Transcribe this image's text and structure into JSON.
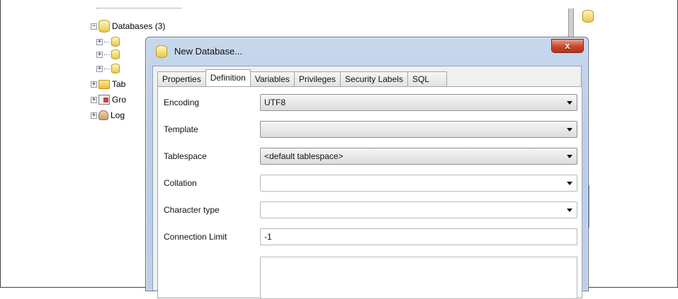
{
  "tree": {
    "databases_label": "Databases (3)",
    "tables_label": "Tab",
    "groups_label": "Gro",
    "logins_label": "Log"
  },
  "dialog": {
    "title": "New Database...",
    "close_label": "x",
    "tabs": [
      {
        "label": "Properties"
      },
      {
        "label": "Definition"
      },
      {
        "label": "Variables"
      },
      {
        "label": "Privileges"
      },
      {
        "label": "Security Labels"
      },
      {
        "label": "SQL"
      }
    ],
    "active_tab": "Definition",
    "fields": {
      "encoding_label": "Encoding",
      "encoding_value": "UTF8",
      "template_label": "Template",
      "template_value": "",
      "tablespace_label": "Tablespace",
      "tablespace_value": "<default tablespace>",
      "collation_label": "Collation",
      "collation_value": "",
      "character_type_label": "Character type",
      "character_type_value": "",
      "connection_limit_label": "Connection Limit",
      "connection_limit_value": "-1"
    }
  },
  "colors": {
    "dialog_frame": "#bcd0e8",
    "close_button": "#c9472a",
    "db_icon": "#e8c94a"
  }
}
